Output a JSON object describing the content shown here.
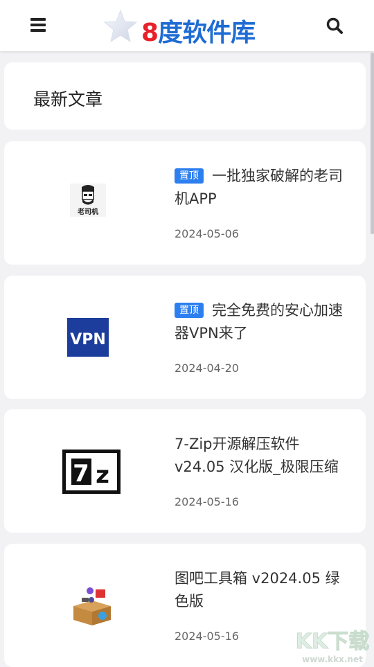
{
  "header": {
    "logo": {
      "number": "8",
      "text": "度软件库"
    }
  },
  "section": {
    "title": "最新文章"
  },
  "articles": [
    {
      "badge": "置顶",
      "title": "一批独家破解的老司机APP",
      "date": "2024-05-06",
      "thumb_text": "老司机"
    },
    {
      "badge": "置顶",
      "title": "完全免费的安心加速器VPN来了",
      "date": "2024-04-20",
      "thumb_text": "VPN"
    },
    {
      "badge": "",
      "title": "7-Zip开源解压软件 v24.05 汉化版_极限压缩",
      "date": "2024-05-16",
      "thumb_text": "7z"
    },
    {
      "badge": "",
      "title": "图吧工具箱 v2024.05 绿色版",
      "date": "2024-05-16",
      "thumb_text": ""
    }
  ],
  "watermark": {
    "main": "KK下载",
    "sub": "www.kkx.net"
  },
  "colors": {
    "accent": "#2d7ff0",
    "logo_red": "#e8202a",
    "logo_blue": "#1f6bd4"
  }
}
